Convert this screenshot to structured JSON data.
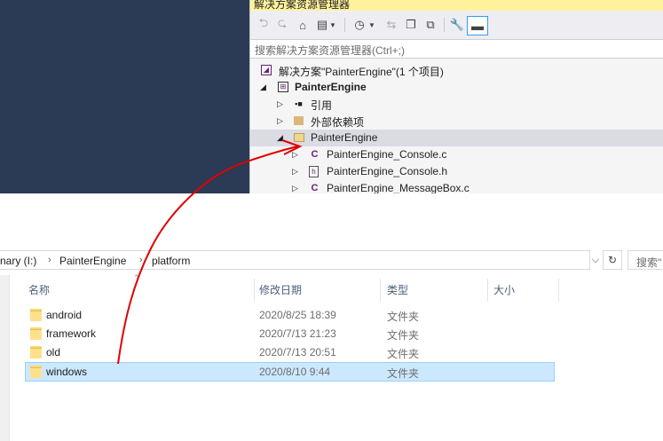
{
  "solution_explorer": {
    "title": "解决方案资源管理器",
    "toolbar": {
      "icons": [
        "back-icon",
        "forward-icon",
        "home-icon",
        "switch-views-icon",
        "dropdown-icon",
        "pending-changes-icon",
        "dropdown-icon",
        "sync-icon",
        "collapse-all-icon",
        "show-all-files-icon",
        "properties-icon",
        "preview-icon"
      ]
    },
    "search_placeholder": "搜索解决方案资源管理器(Ctrl+;)",
    "tree": {
      "solution": "解决方案\"PainterEngine\"(1 个项目)",
      "project": "PainterEngine",
      "references": "引用",
      "external_deps": "外部依赖项",
      "folder": "PainterEngine",
      "files": [
        "PainterEngine_Console.c",
        "PainterEngine_Console.h",
        "PainterEngine_MessageBox.c"
      ]
    }
  },
  "explorer": {
    "breadcrumb": [
      "nary (I:)",
      "PainterEngine",
      "platform"
    ],
    "search_placeholder": "搜索\"",
    "columns": {
      "name": "名称",
      "date": "修改日期",
      "type": "类型",
      "size": "大小"
    },
    "rows": [
      {
        "name": "android",
        "date": "2020/8/25 18:39",
        "type": "文件夹"
      },
      {
        "name": "framework",
        "date": "2020/7/13 21:23",
        "type": "文件夹"
      },
      {
        "name": "old",
        "date": "2020/7/13 20:51",
        "type": "文件夹"
      },
      {
        "name": "windows",
        "date": "2020/8/10 9:44",
        "type": "文件夹"
      }
    ],
    "selected_row": "windows"
  },
  "colors": {
    "accent_title": "#fff29d",
    "selection": "#cce8ff",
    "annotation_arrow": "#e00000"
  }
}
